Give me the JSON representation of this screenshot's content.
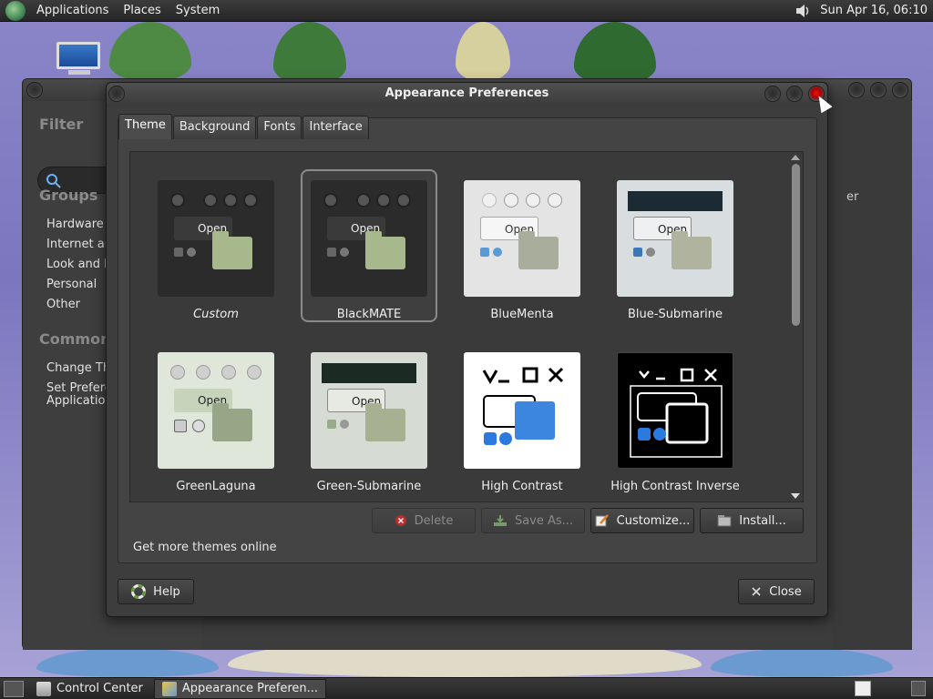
{
  "top_panel": {
    "menus": [
      "Applications",
      "Places",
      "System"
    ],
    "clock": "Sun Apr 16, 06:10"
  },
  "control_center": {
    "filter_heading": "Filter",
    "groups_heading": "Groups",
    "groups": [
      "Hardware",
      "Internet and",
      "Look and Fe",
      "Personal",
      "Other"
    ],
    "common_heading": "Common",
    "common": [
      "Change The",
      "Set Prefere",
      "Applications"
    ],
    "right_fragment": "er"
  },
  "dialog": {
    "title": "Appearance Preferences",
    "tabs": [
      "Theme",
      "Background",
      "Fonts",
      "Interface"
    ],
    "active_tab": "Theme",
    "themes": [
      {
        "name": "Custom",
        "open": "Open"
      },
      {
        "name": "BlackMATE",
        "open": "Open"
      },
      {
        "name": "BlueMenta",
        "open": "Open"
      },
      {
        "name": "Blue-Submarine",
        "open": "Open"
      },
      {
        "name": "GreenLaguna",
        "open": "Open"
      },
      {
        "name": "Green-Submarine",
        "open": "Open"
      },
      {
        "name": "High Contrast",
        "open": ""
      },
      {
        "name": "High Contrast Inverse",
        "open": ""
      }
    ],
    "selected_theme": "BlackMATE",
    "buttons": {
      "delete": "Delete",
      "save_as": "Save As...",
      "customize": "Customize...",
      "install": "Install..."
    },
    "get_more": "Get more themes online",
    "help": "Help",
    "close": "Close"
  },
  "taskbar": {
    "tasks": [
      "Control Center",
      "Appearance Preferen..."
    ]
  }
}
